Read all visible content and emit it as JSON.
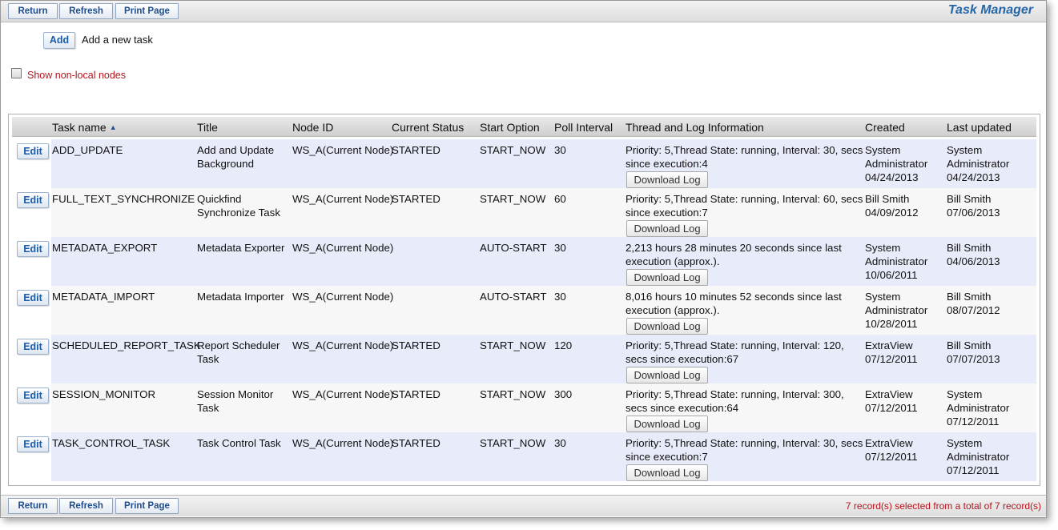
{
  "toolbar": {
    "return_label": "Return",
    "refresh_label": "Refresh",
    "print_label": "Print Page",
    "page_title": "Task Manager"
  },
  "add": {
    "button_label": "Add",
    "text": "Add a new task"
  },
  "nonlocal": {
    "label": "Show non-local nodes",
    "checked": false
  },
  "table": {
    "headers": {
      "task_name": "Task name",
      "title": "Title",
      "node_id": "Node ID",
      "current_status": "Current Status",
      "start_option": "Start Option",
      "poll_interval": "Poll Interval",
      "thread_log": "Thread and Log Information",
      "created": "Created",
      "last_updated": "Last updated"
    },
    "sort_icon": "sort-ascending-icon",
    "edit_label": "Edit",
    "download_label": "Download Log",
    "rows": [
      {
        "task_name": "ADD_UPDATE",
        "title_l1": "Add and Update",
        "title_l2": "Background",
        "node_id": "WS_A(Current Node)",
        "status": "STARTED",
        "start_option": "START_NOW",
        "poll_interval": "30",
        "info_l1": "Priority: 5,Thread State: running, Interval: 30, secs",
        "info_l2": "since execution:4",
        "created_l1": "System",
        "created_l2": "Administrator",
        "created_l3": "04/24/2013",
        "updated_l1": "System",
        "updated_l2": "Administrator",
        "updated_l3": "04/24/2013"
      },
      {
        "task_name": "FULL_TEXT_SYNCHRONIZE",
        "title_l1": "Quickfind",
        "title_l2": "Synchronize Task",
        "node_id": "WS_A(Current Node)",
        "status": "STARTED",
        "start_option": "START_NOW",
        "poll_interval": "60",
        "info_l1": "Priority: 5,Thread State: running, Interval: 60, secs",
        "info_l2": "since execution:7",
        "created_l1": "Bill Smith",
        "created_l2": "04/09/2012",
        "created_l3": "",
        "updated_l1": "Bill Smith",
        "updated_l2": "07/06/2013",
        "updated_l3": ""
      },
      {
        "task_name": "METADATA_EXPORT",
        "title_l1": "Metadata Exporter",
        "title_l2": "",
        "node_id": "WS_A(Current Node)",
        "status": "",
        "start_option": "AUTO-START",
        "poll_interval": "30",
        "info_l1": "2,213 hours 28 minutes 20 seconds since last",
        "info_l2": "execution (approx.).",
        "created_l1": "System",
        "created_l2": "Administrator",
        "created_l3": "10/06/2011",
        "updated_l1": "Bill Smith",
        "updated_l2": "04/06/2013",
        "updated_l3": ""
      },
      {
        "task_name": "METADATA_IMPORT",
        "title_l1": "Metadata Importer",
        "title_l2": "",
        "node_id": "WS_A(Current Node)",
        "status": "",
        "start_option": "AUTO-START",
        "poll_interval": "30",
        "info_l1": "8,016 hours 10 minutes 52 seconds since last",
        "info_l2": "execution (approx.).",
        "created_l1": "System",
        "created_l2": "Administrator",
        "created_l3": "10/28/2011",
        "updated_l1": "Bill Smith",
        "updated_l2": "08/07/2012",
        "updated_l3": ""
      },
      {
        "task_name": "SCHEDULED_REPORT_TASK",
        "title_l1": "Report Scheduler",
        "title_l2": "Task",
        "node_id": "WS_A(Current Node)",
        "status": "STARTED",
        "start_option": "START_NOW",
        "poll_interval": "120",
        "info_l1": "Priority: 5,Thread State: running, Interval: 120,",
        "info_l2": "secs since execution:67",
        "created_l1": "ExtraView",
        "created_l2": "07/12/2011",
        "created_l3": "",
        "updated_l1": "Bill Smith",
        "updated_l2": "07/07/2013",
        "updated_l3": ""
      },
      {
        "task_name": "SESSION_MONITOR",
        "title_l1": "Session Monitor",
        "title_l2": "Task",
        "node_id": "WS_A(Current Node)",
        "status": "STARTED",
        "start_option": "START_NOW",
        "poll_interval": "300",
        "info_l1": "Priority: 5,Thread State: running, Interval: 300,",
        "info_l2": "secs since execution:64",
        "created_l1": "ExtraView",
        "created_l2": "07/12/2011",
        "created_l3": "",
        "updated_l1": "System",
        "updated_l2": "Administrator",
        "updated_l3": "07/12/2011"
      },
      {
        "task_name": "TASK_CONTROL_TASK",
        "title_l1": "Task Control Task",
        "title_l2": "",
        "node_id": "WS_A(Current Node)",
        "status": "STARTED",
        "start_option": "START_NOW",
        "poll_interval": "30",
        "info_l1": "Priority: 5,Thread State: running, Interval: 30, secs",
        "info_l2": "since execution:7",
        "created_l1": "ExtraView",
        "created_l2": "07/12/2011",
        "created_l3": "",
        "updated_l1": "System",
        "updated_l2": "Administrator",
        "updated_l3": "07/12/2011"
      }
    ]
  },
  "footer": {
    "record_count": "7 record(s) selected from a total of 7 record(s)"
  },
  "colors": {
    "accent_blue": "#1a5da8",
    "alert_red": "#b3141b",
    "row_highlight": "#e8ebfa"
  }
}
